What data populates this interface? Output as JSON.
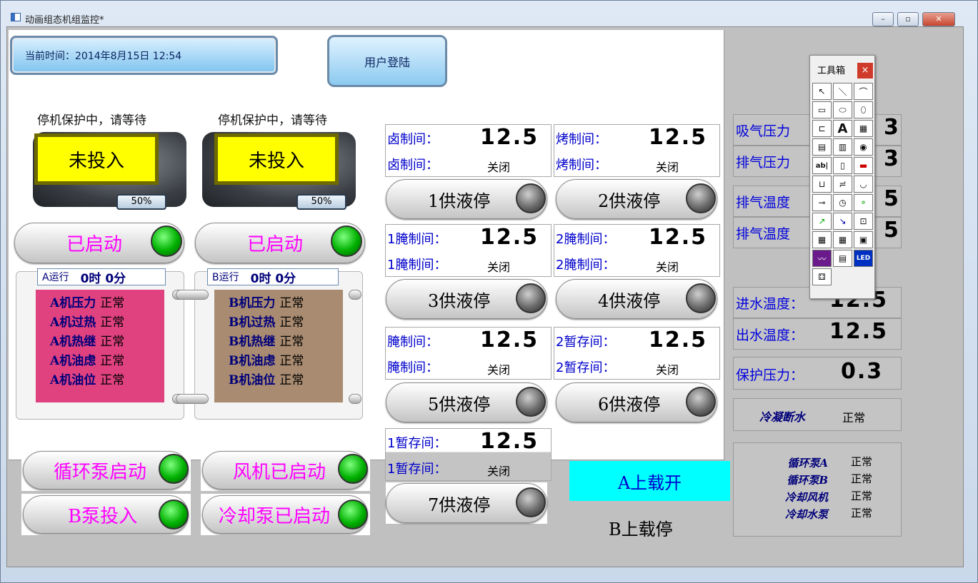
{
  "window": {
    "title": "动画组态机组监控*",
    "min": "–",
    "max": "▫",
    "close": "✕"
  },
  "header": {
    "time_label": "当前时间：2014年8月15日 12:54",
    "login": "用户登陆"
  },
  "units": [
    {
      "status": "停机保护中，请等待",
      "state": "未投入",
      "pct": "50%",
      "start": "已启动",
      "run_label": "A运行",
      "run_time": "0时 0分",
      "items": [
        {
          "k": "A机压力",
          "v": "正常"
        },
        {
          "k": "A机过热",
          "v": "正常"
        },
        {
          "k": "A机热继",
          "v": "正常"
        },
        {
          "k": "A机油虑",
          "v": "正常"
        },
        {
          "k": "A机油位",
          "v": "正常"
        }
      ]
    },
    {
      "status": "停机保护中，请等待",
      "state": "未投入",
      "pct": "50%",
      "start": "已启动",
      "run_label": "B运行",
      "run_time": "0时 0分",
      "items": [
        {
          "k": "B机压力",
          "v": "正常"
        },
        {
          "k": "B机过热",
          "v": "正常"
        },
        {
          "k": "B机热继",
          "v": "正常"
        },
        {
          "k": "B机油虑",
          "v": "正常"
        },
        {
          "k": "B机油位",
          "v": "正常"
        }
      ]
    }
  ],
  "bottom_buttons": [
    "循环泵启动",
    "风机已启动",
    "B泵投入",
    "冷却泵已启动"
  ],
  "rooms": [
    {
      "l1": "卤制间：",
      "v": "12.5",
      "l2": "卤制间：",
      "s": "关闭",
      "btn": "1供液停"
    },
    {
      "l1": "烤制间：",
      "v": "12.5",
      "l2": "烤制间：",
      "s": "关闭",
      "btn": "2供液停"
    },
    {
      "l1": "1腌制间：",
      "v": "12.5",
      "l2": "1腌制间：",
      "s": "关闭",
      "btn": "3供液停"
    },
    {
      "l1": "2腌制间：",
      "v": "12.5",
      "l2": "2腌制间：",
      "s": "关闭",
      "btn": "4供液停"
    },
    {
      "l1": "腌制间：",
      "v": "12.5",
      "l2": "腌制间：",
      "s": "关闭",
      "btn": "5供液停"
    },
    {
      "l1": "2暂存间：",
      "v": "12.5",
      "l2": "2暂存间：",
      "s": "关闭",
      "btn": "6供液停"
    },
    {
      "l1": "1暂存间：",
      "v": "12.5",
      "l2": "1暂存间：",
      "s": "关闭",
      "btn": "7供液停"
    }
  ],
  "load": {
    "a": "A上载开",
    "b": "B上载停"
  },
  "right": {
    "suction": "吸气压力",
    "suction_v": "3",
    "discharge": "排气压力",
    "discharge_v": "3",
    "temp1": "排气温度",
    "temp1_v": "5",
    "temp2": "排气温度",
    "temp2_v": "5",
    "inlet": "进水温度：",
    "inlet_v": "12.5",
    "outlet": "出水温度：",
    "outlet_v": "12.5",
    "protect": "保护压力：",
    "protect_v": "0.3",
    "cond": "冷凝断水",
    "cond_v": "正常",
    "list": [
      {
        "k": "循环泵A",
        "v": "正常"
      },
      {
        "k": "循环泵B",
        "v": "正常"
      },
      {
        "k": "冷却风机",
        "v": "正常"
      },
      {
        "k": "冷却水泵",
        "v": "正常"
      }
    ]
  },
  "toolbox": {
    "title": "工具箱",
    "close": "×",
    "tools": [
      "↖",
      "＼",
      "⌒",
      "▭",
      "⬭",
      "⬯",
      "⊏",
      "A",
      "▦",
      "▤",
      "▥",
      "◉",
      "ab|",
      "▯",
      "▬",
      "⊔",
      "≓",
      "◡",
      "⊸",
      "◷",
      "⚬",
      "↗",
      "↘",
      "⊡",
      "▦",
      "▦",
      "▣",
      "〰",
      "▤",
      "LED",
      "⚃"
    ]
  }
}
